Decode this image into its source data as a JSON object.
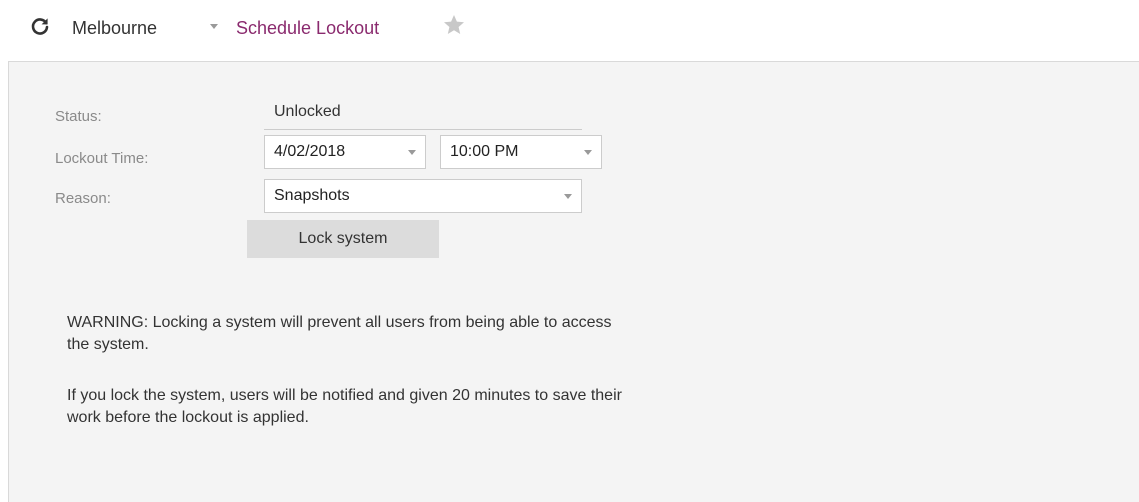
{
  "header": {
    "refresh_icon": "refresh-icon",
    "breadcrumb_root": "Melbourne",
    "breadcrumb_current": "Schedule Lockout",
    "favorite_icon": "star-icon",
    "accent_color": "#8a2a6e",
    "star_color": "#c8c8c8"
  },
  "form": {
    "status_label": "Status:",
    "status_value": "Unlocked",
    "lockout_time_label": "Lockout Time:",
    "lockout_date": "4/02/2018",
    "lockout_time": "10:00 PM",
    "reason_label": "Reason:",
    "reason_value": "Snapshots",
    "lock_button_label": "Lock system"
  },
  "warnings": {
    "paragraph_1": "WARNING: Locking a system will prevent all users from being able to access the system.",
    "paragraph_2": "If you lock the system, users will be notified and given 20 minutes to save their work before the lockout is applied."
  }
}
